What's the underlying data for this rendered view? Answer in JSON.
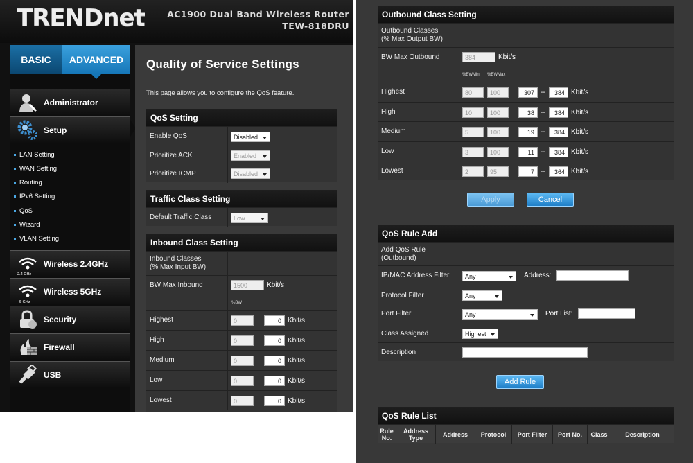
{
  "brand": {
    "logo": "TRENDnet",
    "model_line1": "AC1900 Dual Band Wireless Router",
    "model_line2": "TEW-818DRU"
  },
  "nav": {
    "tab_basic": "BASIC",
    "tab_advanced": "ADVANCED",
    "menu": {
      "administrator": "Administrator",
      "setup": "Setup",
      "wireless24": "Wireless 2.4GHz",
      "wireless5": "Wireless 5GHz",
      "security": "Security",
      "firewall": "Firewall",
      "usb": "USB"
    },
    "icon_24": "2.4 GHz",
    "icon_5": "5 GHz",
    "setup_sub": [
      "LAN Setting",
      "WAN Setting",
      "Routing",
      "IPv6 Setting",
      "QoS",
      "Wizard",
      "VLAN Setting"
    ]
  },
  "page": {
    "title": "Quality of Service Settings",
    "desc": "This page allows you to configure the QoS feature."
  },
  "qos": {
    "header": "QoS Setting",
    "enable_label": "Enable QoS",
    "enable_value": "Disabled",
    "ack_label": "Prioritize ACK",
    "ack_value": "Enabled",
    "icmp_label": "Prioritize ICMP",
    "icmp_value": "Disabled"
  },
  "traffic": {
    "header": "Traffic Class Setting",
    "label": "Default Traffic Class",
    "value": "Low"
  },
  "inbound": {
    "header": "Inbound Class Setting",
    "classes_label": "Inbound Classes\n(% Max Input BW)",
    "bwmax_label": "BW Max Inbound",
    "bwmax_value": "1500",
    "unit": "Kbit/s",
    "col_bw": "%BW",
    "rows": [
      {
        "name": "Highest",
        "bw": "0",
        "kbit": "0"
      },
      {
        "name": "High",
        "bw": "0",
        "kbit": "0"
      },
      {
        "name": "Medium",
        "bw": "0",
        "kbit": "0"
      },
      {
        "name": "Low",
        "bw": "0",
        "kbit": "0"
      },
      {
        "name": "Lowest",
        "bw": "0",
        "kbit": "0"
      }
    ]
  },
  "outbound": {
    "header": "Outbound Class Setting",
    "classes_label": "Outbound Classes\n(% Max Output BW)",
    "bwmax_label": "BW Max Outbound",
    "bwmax_value": "384",
    "unit": "Kbit/s",
    "col_min": "%BWMin",
    "col_max": "%BWMax",
    "dash": "--",
    "rows": [
      {
        "name": "Highest",
        "min": "80",
        "max": "100",
        "kmin": "307",
        "kmax": "384"
      },
      {
        "name": "High",
        "min": "10",
        "max": "100",
        "kmin": "38",
        "kmax": "384"
      },
      {
        "name": "Medium",
        "min": "5",
        "max": "100",
        "kmin": "19",
        "kmax": "384"
      },
      {
        "name": "Low",
        "min": "3",
        "max": "100",
        "kmin": "11",
        "kmax": "384"
      },
      {
        "name": "Lowest",
        "min": "2",
        "max": "95",
        "kmin": "7",
        "kmax": "364"
      }
    ]
  },
  "buttons": {
    "apply": "Apply",
    "cancel": "Cancel",
    "add_rule": "Add Rule"
  },
  "rule_add": {
    "header": "QoS Rule Add",
    "add_label": "Add QoS Rule\n(Outbound)",
    "ipmac_label": "IP/MAC Address Filter",
    "ipmac_value": "Any",
    "address_label": "Address:",
    "protocol_label": "Protocol Filter",
    "protocol_value": "Any",
    "port_label": "Port Filter",
    "port_value": "Any",
    "portlist_label": "Port List:",
    "class_label": "Class Assigned",
    "class_value": "Highest",
    "desc_label": "Description"
  },
  "rule_list": {
    "header": "QoS Rule List",
    "columns": [
      "Rule No.",
      "Address Type",
      "Address",
      "Protocol",
      "Port Filter",
      "Port No.",
      "Class",
      "Description"
    ]
  }
}
